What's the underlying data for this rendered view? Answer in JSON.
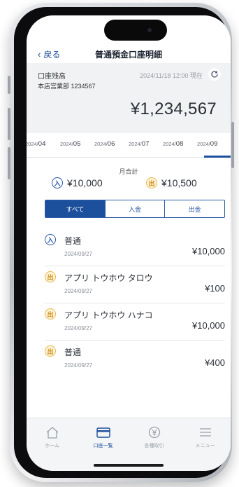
{
  "header": {
    "back_label": "戻る",
    "title": "普通預金口座明細"
  },
  "balance": {
    "label": "口座残高",
    "branch_account": "本店営業部 1234567",
    "timestamp": "2024/11/18 12:00 現在",
    "amount": "¥1,234,567"
  },
  "months": [
    {
      "year": "2024/",
      "month": "04"
    },
    {
      "year": "2024/",
      "month": "05"
    },
    {
      "year": "2024/",
      "month": "06"
    },
    {
      "year": "2024/",
      "month": "07"
    },
    {
      "year": "2024/",
      "month": "08"
    },
    {
      "year": "2024/",
      "month": "09"
    }
  ],
  "selected_month": "2024/09",
  "summary": {
    "label": "月合計",
    "in_icon": "入",
    "in_amount": "¥10,000",
    "out_icon": "出",
    "out_amount": "¥10,500"
  },
  "filter": {
    "all": "すべて",
    "deposit": "入金",
    "withdrawal": "出金",
    "selected": "すべて"
  },
  "transactions": [
    {
      "type_icon": "入",
      "kind": "in",
      "name": "普通",
      "date": "2024/09/27",
      "amount": "¥10,000"
    },
    {
      "type_icon": "出",
      "kind": "out",
      "name": "アプリ トウホウ タロウ",
      "date": "2024/09/27",
      "amount": "¥100"
    },
    {
      "type_icon": "出",
      "kind": "out",
      "name": "アプリ トウホウ ハナコ",
      "date": "2024/09/27",
      "amount": "¥10,000"
    },
    {
      "type_icon": "出",
      "kind": "out",
      "name": "普通",
      "date": "2024/09/27",
      "amount": "¥400"
    }
  ],
  "tabbar": {
    "home": "ホーム",
    "accounts": "口座一覧",
    "transactions": "各種取引",
    "menu": "メニュー",
    "active": "口座一覧"
  },
  "colors": {
    "primary": "#1c4f9c",
    "in": "#2556a8",
    "out": "#e6b84a"
  }
}
